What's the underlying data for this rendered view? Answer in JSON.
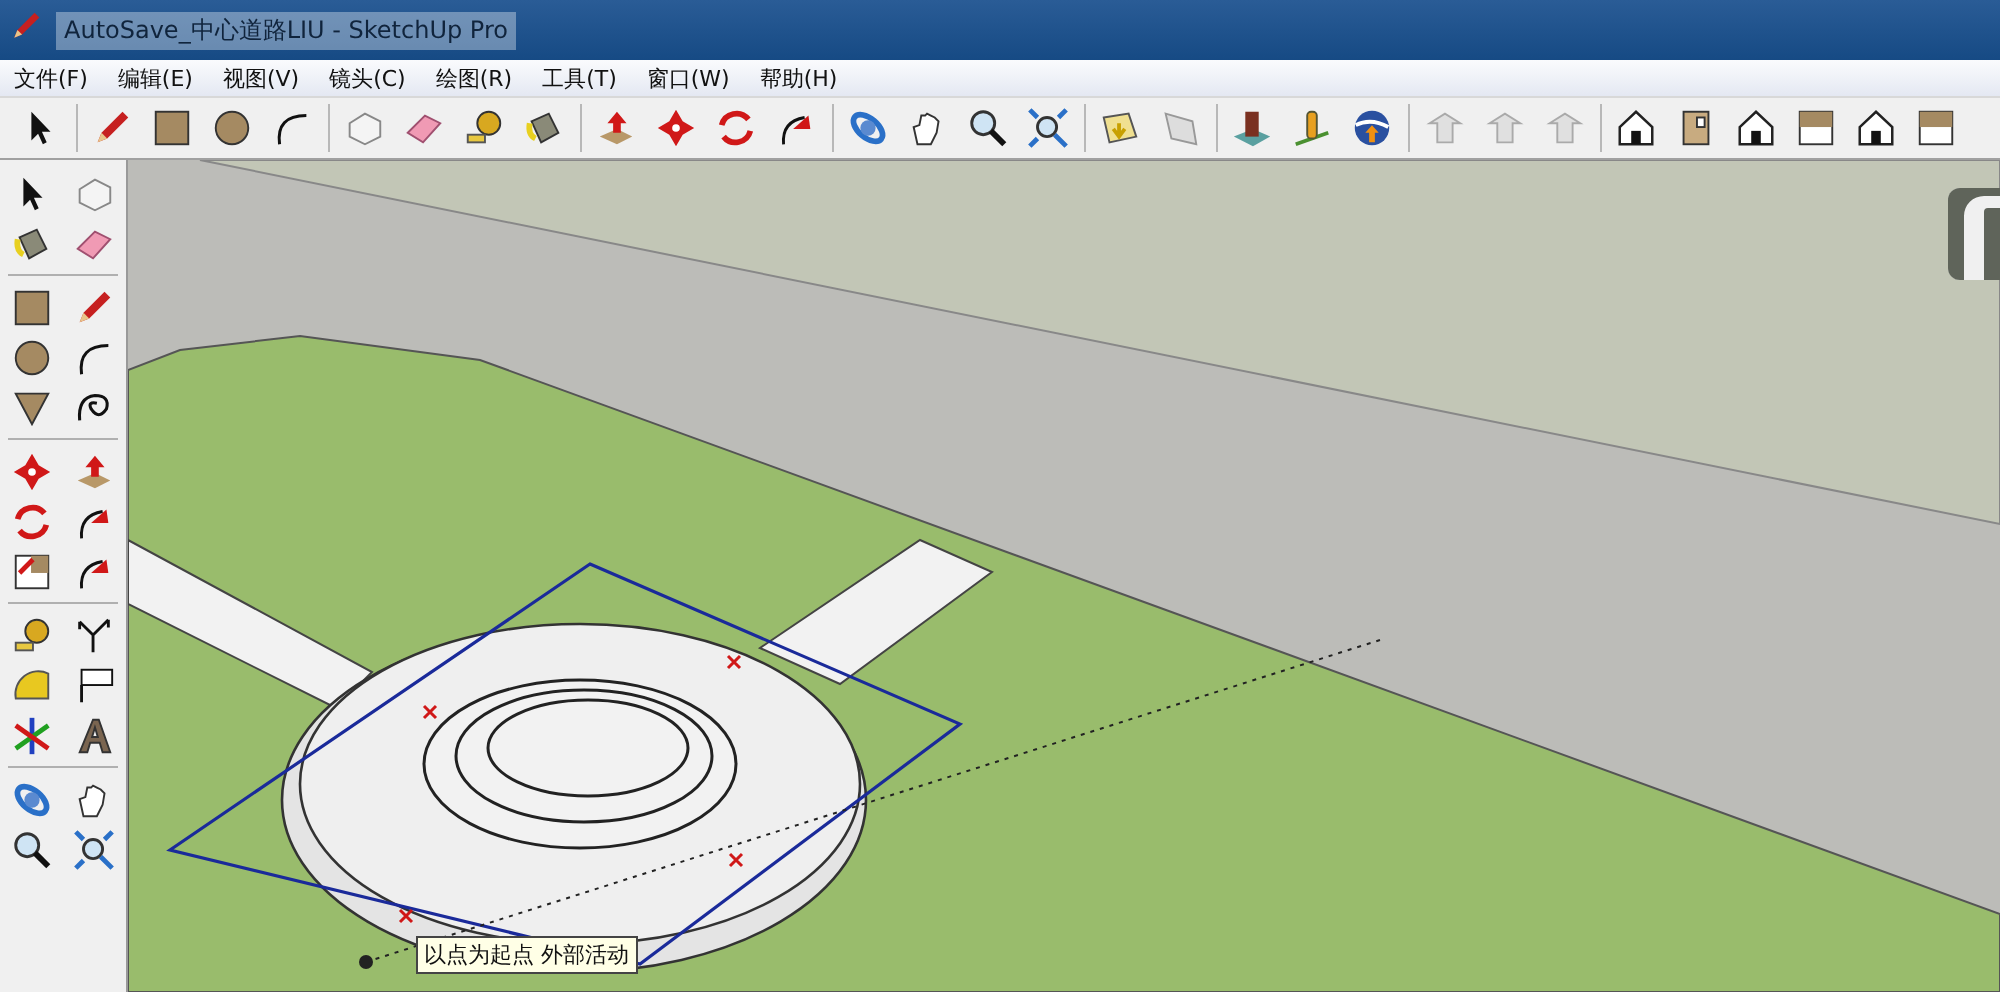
{
  "window": {
    "title": "AutoSave_中心道路LIU - SketchUp Pro"
  },
  "menu": [
    {
      "label": "文件(F)"
    },
    {
      "label": "编辑(E)"
    },
    {
      "label": "视图(V)"
    },
    {
      "label": "镜头(C)"
    },
    {
      "label": "绘图(R)"
    },
    {
      "label": "工具(T)"
    },
    {
      "label": "窗口(W)"
    },
    {
      "label": "帮助(H)"
    }
  ],
  "tooltip": {
    "text": "以点为起点 外部活动"
  }
}
